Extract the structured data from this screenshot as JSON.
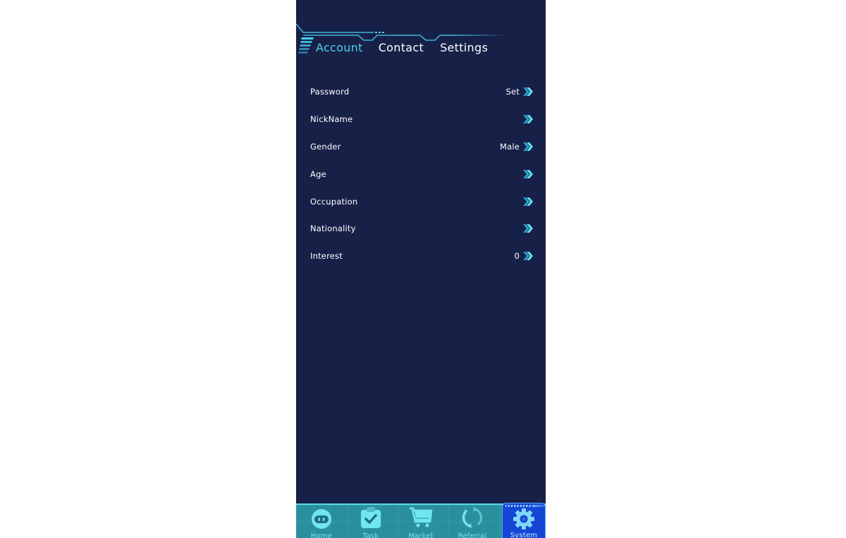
{
  "tabs": {
    "items": [
      {
        "label": "Account",
        "active": true
      },
      {
        "label": "Contact",
        "active": false
      },
      {
        "label": "Settings",
        "active": false
      }
    ]
  },
  "account": {
    "rows": [
      {
        "label": "Password",
        "value": "Set"
      },
      {
        "label": "NickName",
        "value": ""
      },
      {
        "label": "Gender",
        "value": "Male"
      },
      {
        "label": "Age",
        "value": ""
      },
      {
        "label": "Occupation",
        "value": ""
      },
      {
        "label": "Nationality",
        "value": ""
      },
      {
        "label": "Interest",
        "value": "0"
      }
    ],
    "row_icon": "double-chevron-right-icon"
  },
  "tabbar": {
    "items": [
      {
        "label": "Home",
        "icon": "robot-face-icon",
        "active": false
      },
      {
        "label": "Task",
        "icon": "clipboard-check-icon",
        "active": false
      },
      {
        "label": "Market",
        "icon": "cart-icon",
        "active": false
      },
      {
        "label": "Referral",
        "icon": "refresh-cycle-icon",
        "active": false
      },
      {
        "label": "System",
        "icon": "gear-icon",
        "active": true
      }
    ]
  },
  "colors": {
    "background": "#172047",
    "accent": "#4fd3e8",
    "tabbar": "#2a8f9c",
    "tabbar_active": "#1546d6",
    "text": "#ffffff"
  }
}
